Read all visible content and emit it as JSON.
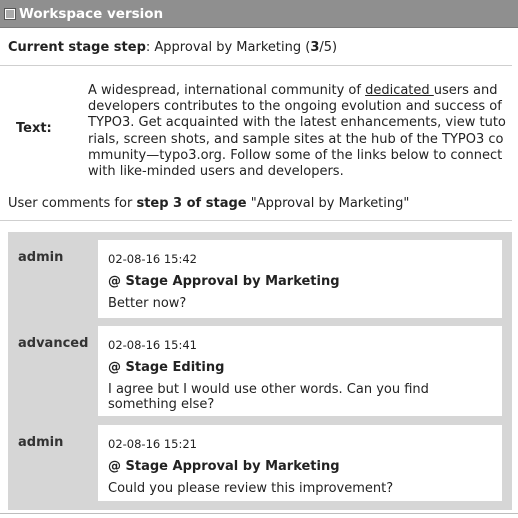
{
  "header": {
    "title": "Workspace version",
    "icon": "document-list-icon"
  },
  "stage": {
    "label": "Current stage step",
    "stage_name": "Approval by Marketing",
    "step_current": "3",
    "step_total": "5"
  },
  "text_field": {
    "label": "Text:",
    "before": "A widespread, international community of ",
    "underlined": "dedicated ",
    "after": "users and developers contributes to the ongoing evolution and success of TYPO3. Get acquainted with the latest enhancements, view tutorials, screen shots, and sample sites at the hub of the TYPO3 community—typo3.org. Follow some of the links below to connect with like-minded users and developers."
  },
  "comments_header": {
    "prefix": "User comments for ",
    "bold": "step 3 of stage",
    "suffix": " \"Approval by Marketing\""
  },
  "comments": [
    {
      "author": "admin",
      "timestamp": "02-08-16 15:42",
      "stage": "@ Stage Approval by Marketing",
      "message": "Better now?"
    },
    {
      "author": "advanced",
      "timestamp": "02-08-16 15:41",
      "stage": "@ Stage Editing",
      "message": "I agree but I would use other words. Can you find something else?"
    },
    {
      "author": "admin",
      "timestamp": "02-08-16 15:21",
      "stage": "@ Stage Approval by Marketing",
      "message": "Could you please review this improvement?"
    }
  ]
}
